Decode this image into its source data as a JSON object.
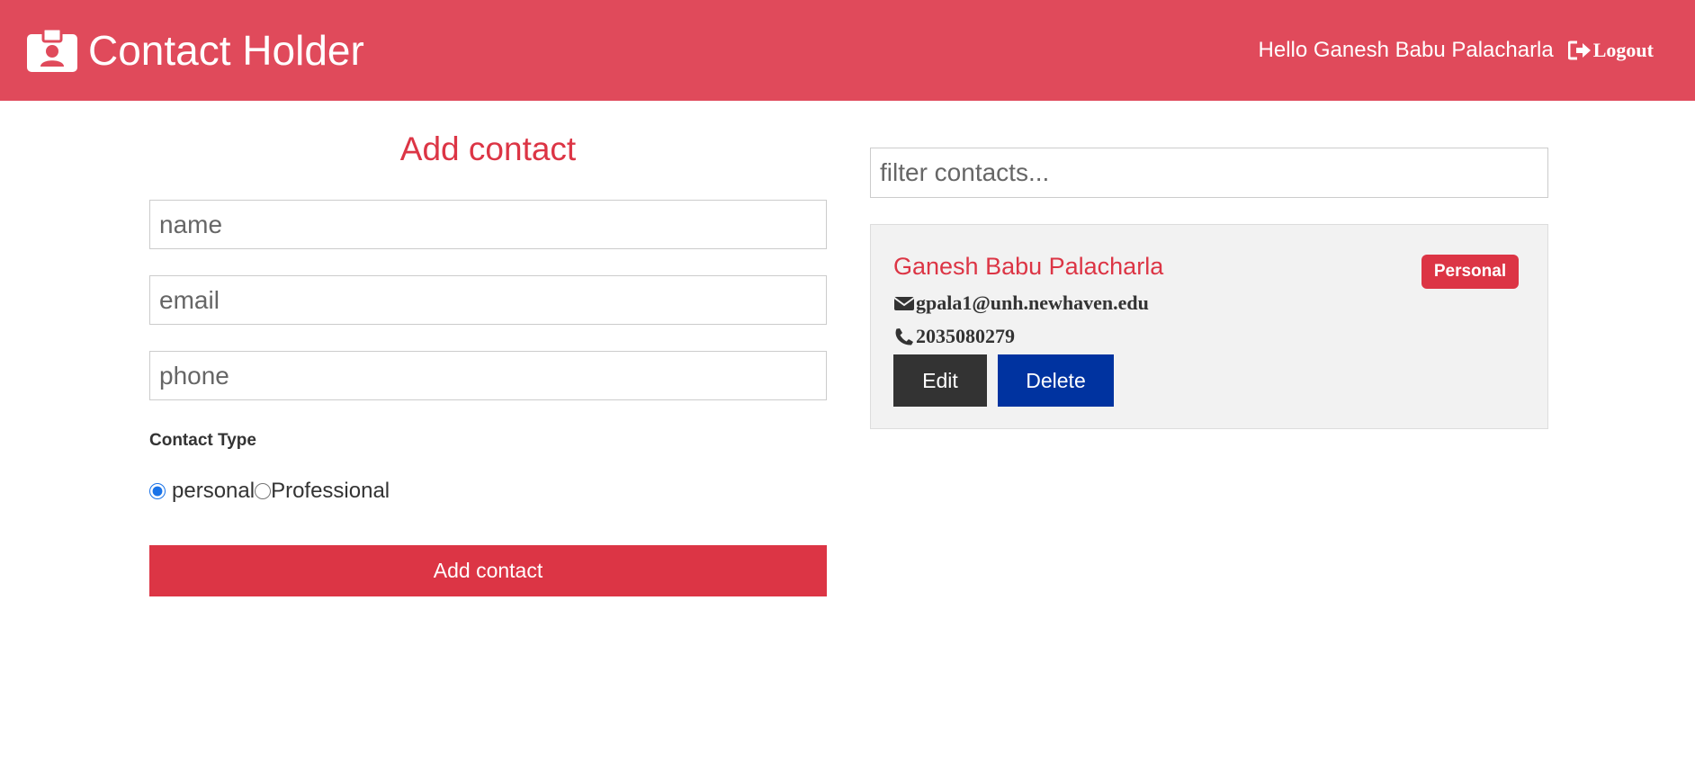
{
  "navbar": {
    "brand_icon": "id-badge-icon",
    "title": "Contact Holder",
    "greeting": "Hello Ganesh Babu Palacharla",
    "logout_icon": "sign-out-icon",
    "logout_label": "Logout",
    "bg_color": "#e04a5b"
  },
  "form": {
    "title": "Add contact",
    "name_placeholder": "name",
    "email_placeholder": "email",
    "phone_placeholder": "phone",
    "name_value": "",
    "email_value": "",
    "phone_value": "",
    "type_label": "Contact Type",
    "radio_options": [
      {
        "label": "personal",
        "checked": true
      },
      {
        "label": "Professional",
        "checked": false
      }
    ],
    "submit_label": "Add contact",
    "accent_color": "#dc3545"
  },
  "filter": {
    "placeholder": "filter contacts...",
    "value": ""
  },
  "contacts": [
    {
      "name": "Ganesh Babu Palacharla",
      "type_badge": "Personal",
      "email_icon": "envelope-icon",
      "email": "gpala1@unh.newhaven.edu",
      "phone_icon": "phone-icon",
      "phone": "2035080279",
      "edit_label": "Edit",
      "delete_label": "Delete",
      "edit_color": "#333333",
      "delete_color": "#0033a0"
    }
  ]
}
